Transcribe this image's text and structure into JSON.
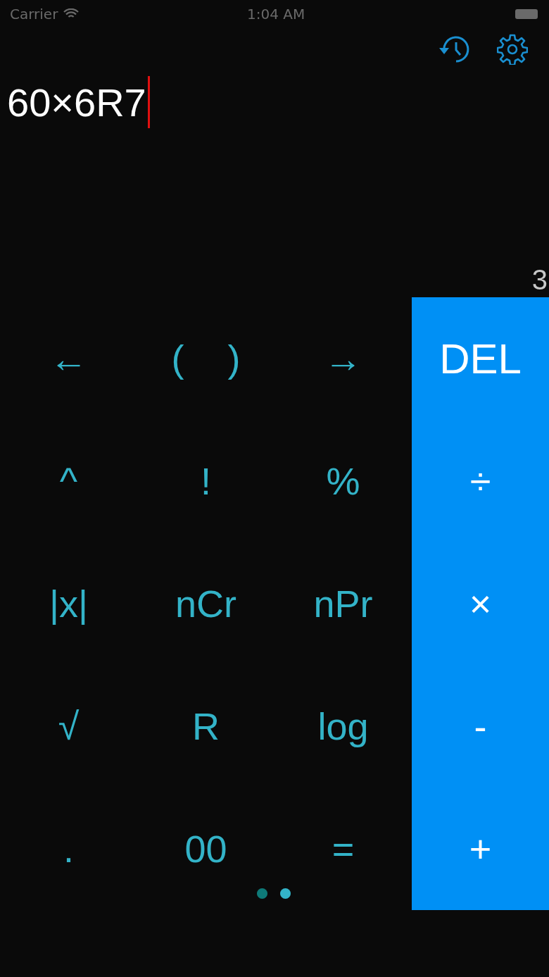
{
  "status_bar": {
    "carrier": "Carrier",
    "time": "1:04 AM"
  },
  "expression": "60×6R7",
  "result": "3",
  "keys": [
    [
      {
        "kind": "single",
        "label": "←"
      },
      {
        "kind": "pair",
        "labels": [
          "(",
          ")"
        ]
      },
      {
        "kind": "single",
        "label": "→"
      }
    ],
    [
      {
        "kind": "single",
        "label": "^"
      },
      {
        "kind": "single",
        "label": "!"
      },
      {
        "kind": "single",
        "label": "%"
      }
    ],
    [
      {
        "kind": "single",
        "label": "|x|"
      },
      {
        "kind": "single",
        "label": "nCr"
      },
      {
        "kind": "single",
        "label": "nPr"
      }
    ],
    [
      {
        "kind": "single",
        "label": "√"
      },
      {
        "kind": "single",
        "label": "R"
      },
      {
        "kind": "single",
        "label": "log"
      }
    ],
    [
      {
        "kind": "single",
        "label": "."
      },
      {
        "kind": "single",
        "label": "00"
      },
      {
        "kind": "single",
        "label": "="
      }
    ]
  ],
  "operators": [
    "DEL",
    "÷",
    "×",
    "-",
    "+"
  ],
  "pages": [
    {
      "selected": false
    },
    {
      "selected": true
    }
  ]
}
